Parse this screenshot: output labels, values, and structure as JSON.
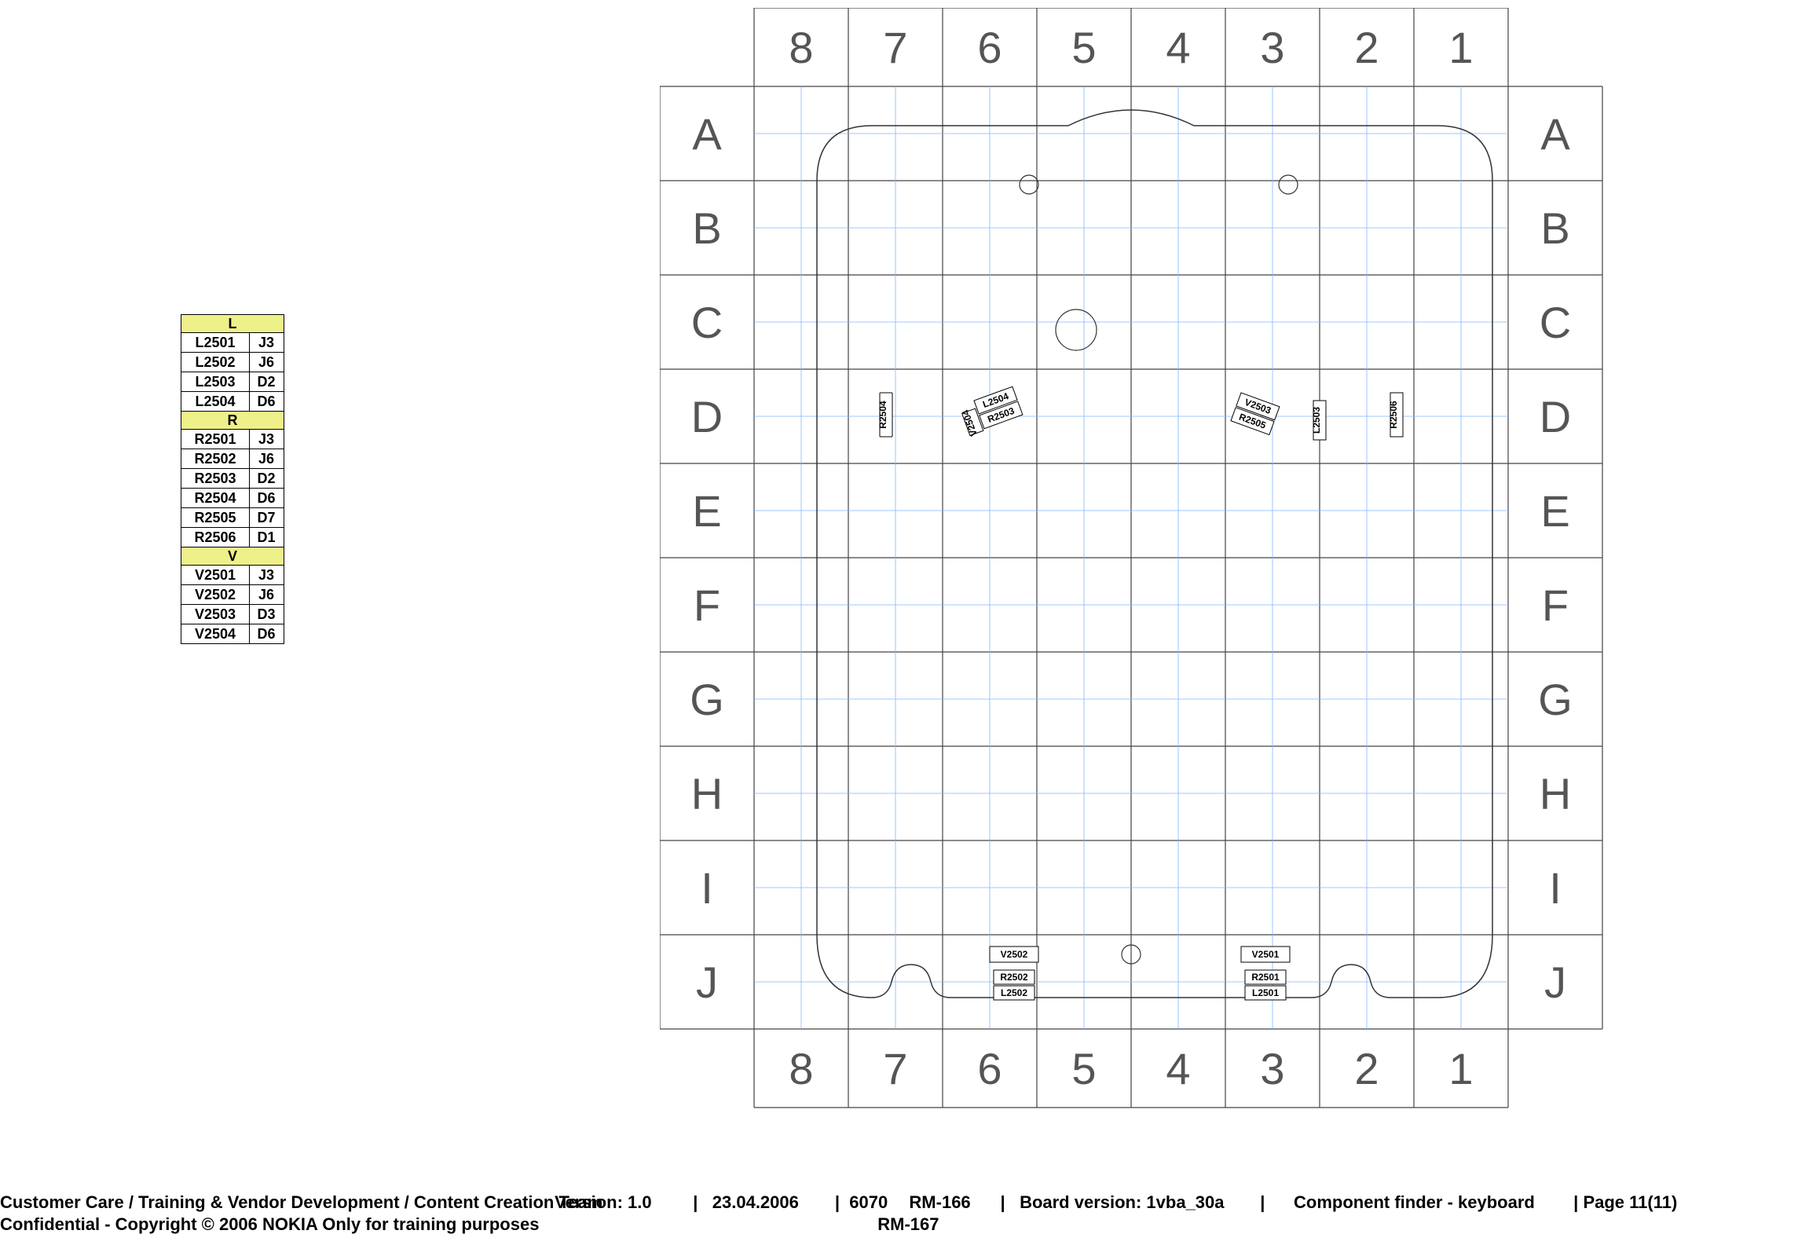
{
  "tables": {
    "L": {
      "hdr": "L",
      "rows": [
        [
          "L2501",
          "J3"
        ],
        [
          "L2502",
          "J6"
        ],
        [
          "L2503",
          "D2"
        ],
        [
          "L2504",
          "D6"
        ]
      ]
    },
    "R": {
      "hdr": "R",
      "rows": [
        [
          "R2501",
          "J3"
        ],
        [
          "R2502",
          "J6"
        ],
        [
          "R2503",
          "D2"
        ],
        [
          "R2504",
          "D6"
        ],
        [
          "R2505",
          "D7"
        ],
        [
          "R2506",
          "D1"
        ]
      ]
    },
    "V": {
      "hdr": "V",
      "rows": [
        [
          "V2501",
          "J3"
        ],
        [
          "V2502",
          "J6"
        ],
        [
          "V2503",
          "D3"
        ],
        [
          "V2504",
          "D6"
        ]
      ]
    }
  },
  "grid": {
    "cols": [
      "8",
      "7",
      "6",
      "5",
      "4",
      "3",
      "2",
      "1"
    ],
    "rows": [
      "A",
      "B",
      "C",
      "D",
      "E",
      "F",
      "G",
      "H",
      "I",
      "J"
    ]
  },
  "components_on_board": {
    "top_left_group": [
      "R2504",
      "L2504",
      "R2503",
      "V2504"
    ],
    "top_right_group": [
      "V2503",
      "R2505",
      "R2506",
      "L2503"
    ],
    "bottom_left_group": [
      "V2502",
      "R2502",
      "L2502"
    ],
    "bottom_right_group": [
      "V2501",
      "R2501",
      "L2501"
    ]
  },
  "footer": {
    "team": "Customer Care / Training & Vendor Development / Content Creation Team",
    "conf": "Confidential - Copyright © 2006 NOKIA Only for training purposes",
    "version_lbl": "Version: 1.0",
    "date": "23.04.2006",
    "prod": "6070",
    "rm1": "RM-166",
    "rm2": "RM-167",
    "board": "Board version: 1vba_30a",
    "title": "Component finder - keyboard",
    "page": "Page 11(11)"
  }
}
